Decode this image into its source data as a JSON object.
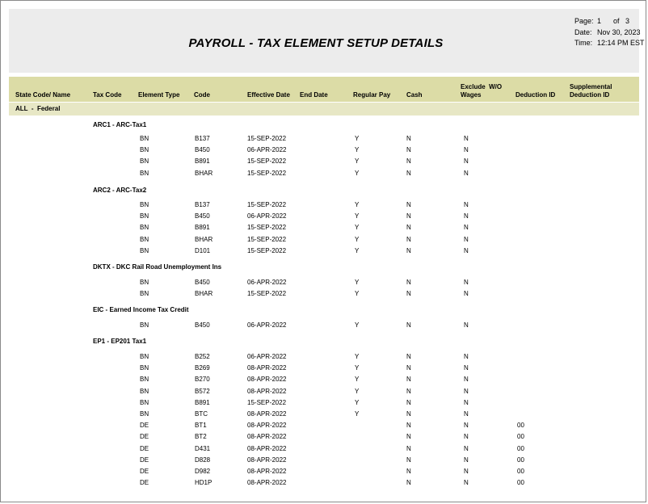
{
  "report": {
    "title": "PAYROLL - TAX ELEMENT SETUP DETAILS",
    "page_label": "Page:",
    "page_num": "1",
    "of_label": "of",
    "page_total": "3",
    "date_label": "Date:",
    "date_value": "Nov 30, 2023",
    "time_label": "Time:",
    "time_value": "12:14 PM EST"
  },
  "columns": {
    "state": "State Code/ Name",
    "tax_code": "Tax Code",
    "element_type": "Element Type",
    "code": "Code",
    "effective_date": "Effective Date",
    "end_date": "End Date",
    "regular_pay": "Regular Pay",
    "cash": "Cash",
    "exclude_1": "Exclude  W/O",
    "exclude_2": "Wages",
    "deduction_id": "Deduction ID",
    "supplemental_1": "Supplemental",
    "supplemental_2": "Deduction ID"
  },
  "group": "ALL  -  Federal",
  "sections": [
    {
      "title": "ARC1 - ARC-Tax1",
      "rows": [
        {
          "type": "BN",
          "code": "B137",
          "eff": "15-SEP-2022",
          "reg": "Y",
          "cash": "N",
          "exc": "N",
          "ded": ""
        },
        {
          "type": "BN",
          "code": "B450",
          "eff": "06-APR-2022",
          "reg": "Y",
          "cash": "N",
          "exc": "N",
          "ded": ""
        },
        {
          "type": "BN",
          "code": "B891",
          "eff": "15-SEP-2022",
          "reg": "Y",
          "cash": "N",
          "exc": "N",
          "ded": ""
        },
        {
          "type": "BN",
          "code": "BHAR",
          "eff": "15-SEP-2022",
          "reg": "Y",
          "cash": "N",
          "exc": "N",
          "ded": ""
        }
      ]
    },
    {
      "title": "ARC2 - ARC-Tax2",
      "rows": [
        {
          "type": "BN",
          "code": "B137",
          "eff": "15-SEP-2022",
          "reg": "Y",
          "cash": "N",
          "exc": "N",
          "ded": ""
        },
        {
          "type": "BN",
          "code": "B450",
          "eff": "06-APR-2022",
          "reg": "Y",
          "cash": "N",
          "exc": "N",
          "ded": ""
        },
        {
          "type": "BN",
          "code": "B891",
          "eff": "15-SEP-2022",
          "reg": "Y",
          "cash": "N",
          "exc": "N",
          "ded": ""
        },
        {
          "type": "BN",
          "code": "BHAR",
          "eff": "15-SEP-2022",
          "reg": "Y",
          "cash": "N",
          "exc": "N",
          "ded": ""
        },
        {
          "type": "BN",
          "code": "D101",
          "eff": "15-SEP-2022",
          "reg": "Y",
          "cash": "N",
          "exc": "N",
          "ded": ""
        }
      ]
    },
    {
      "title": "DKTX - DKC Rail Road Unemployment Ins",
      "rows": [
        {
          "type": "BN",
          "code": "B450",
          "eff": "06-APR-2022",
          "reg": "Y",
          "cash": "N",
          "exc": "N",
          "ded": ""
        },
        {
          "type": "BN",
          "code": "BHAR",
          "eff": "15-SEP-2022",
          "reg": "Y",
          "cash": "N",
          "exc": "N",
          "ded": ""
        }
      ]
    },
    {
      "title": "EIC - Earned Income Tax Credit",
      "rows": [
        {
          "type": "BN",
          "code": "B450",
          "eff": "06-APR-2022",
          "reg": "Y",
          "cash": "N",
          "exc": "N",
          "ded": ""
        }
      ]
    },
    {
      "title": "EP1 - EP201 Tax1",
      "rows": [
        {
          "type": "BN",
          "code": "B252",
          "eff": "06-APR-2022",
          "reg": "Y",
          "cash": "N",
          "exc": "N",
          "ded": ""
        },
        {
          "type": "BN",
          "code": "B269",
          "eff": "08-APR-2022",
          "reg": "Y",
          "cash": "N",
          "exc": "N",
          "ded": ""
        },
        {
          "type": "BN",
          "code": "B270",
          "eff": "08-APR-2022",
          "reg": "Y",
          "cash": "N",
          "exc": "N",
          "ded": ""
        },
        {
          "type": "BN",
          "code": "B572",
          "eff": "08-APR-2022",
          "reg": "Y",
          "cash": "N",
          "exc": "N",
          "ded": ""
        },
        {
          "type": "BN",
          "code": "B891",
          "eff": "15-SEP-2022",
          "reg": "Y",
          "cash": "N",
          "exc": "N",
          "ded": ""
        },
        {
          "type": "BN",
          "code": "BTC",
          "eff": "08-APR-2022",
          "reg": "Y",
          "cash": "N",
          "exc": "N",
          "ded": ""
        },
        {
          "type": "DE",
          "code": "BT1",
          "eff": "08-APR-2022",
          "reg": "",
          "cash": "N",
          "exc": "N",
          "ded": "00"
        },
        {
          "type": "DE",
          "code": "BT2",
          "eff": "08-APR-2022",
          "reg": "",
          "cash": "N",
          "exc": "N",
          "ded": "00"
        },
        {
          "type": "DE",
          "code": "D431",
          "eff": "08-APR-2022",
          "reg": "",
          "cash": "N",
          "exc": "N",
          "ded": "00"
        },
        {
          "type": "DE",
          "code": "D828",
          "eff": "08-APR-2022",
          "reg": "",
          "cash": "N",
          "exc": "N",
          "ded": "00"
        },
        {
          "type": "DE",
          "code": "D982",
          "eff": "08-APR-2022",
          "reg": "",
          "cash": "N",
          "exc": "N",
          "ded": "00"
        },
        {
          "type": "DE",
          "code": "HD1P",
          "eff": "08-APR-2022",
          "reg": "",
          "cash": "N",
          "exc": "N",
          "ded": "00"
        }
      ]
    }
  ]
}
